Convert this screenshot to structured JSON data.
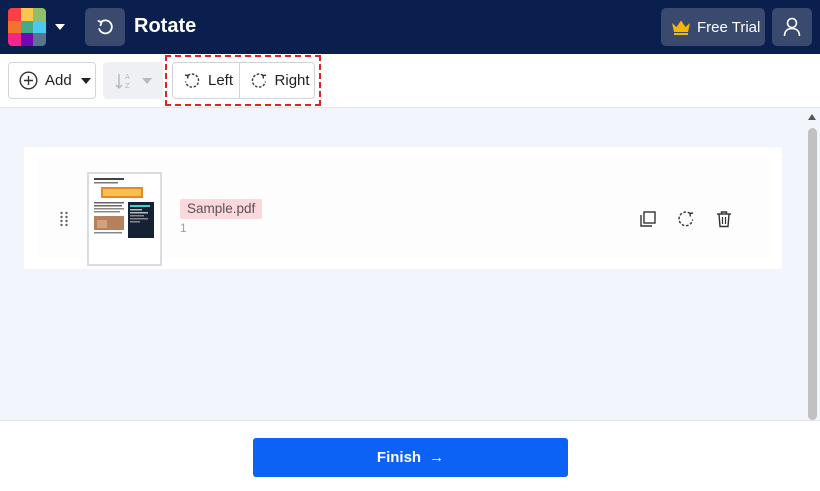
{
  "header": {
    "title": "Rotate",
    "trial_label": "Free Trial",
    "logo_colors": [
      "#f94144",
      "#f9c74f",
      "#90be6d",
      "#f3722c",
      "#43aa8b",
      "#577590",
      "#f72585",
      "#7209b7",
      "#4cc9f0"
    ]
  },
  "toolbar": {
    "add_label": "Add",
    "rotate_left_label": "Left",
    "rotate_right_label": "Right"
  },
  "files": [
    {
      "name": "Sample.pdf",
      "pages": "1"
    }
  ],
  "footer": {
    "finish_label": "Finish",
    "finish_arrow": "→"
  },
  "colors": {
    "topbar": "#0a1f4d",
    "accent": "#0b62f5",
    "highlight_border": "#e02424",
    "filename_tag": "#fcd7dc"
  }
}
